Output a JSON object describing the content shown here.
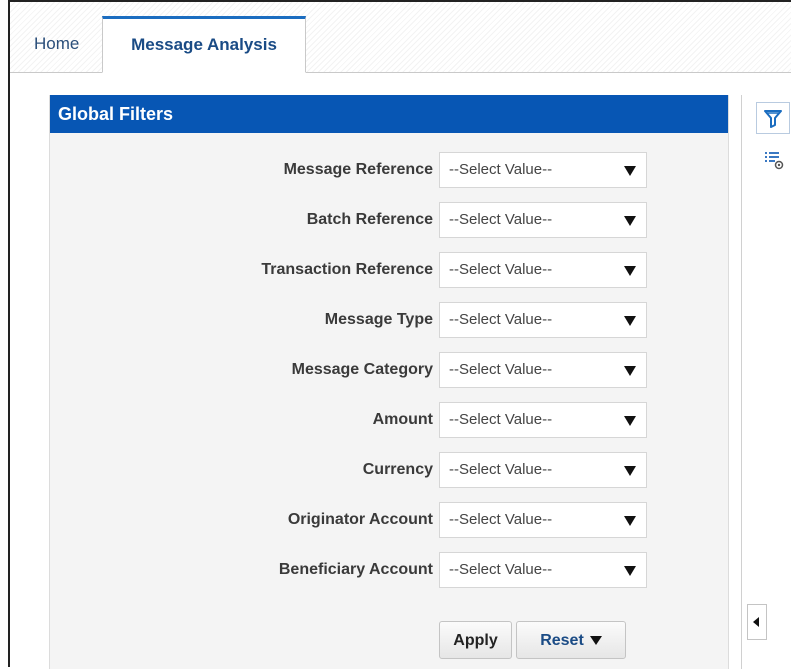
{
  "tabs": [
    {
      "label": "Home",
      "active": false
    },
    {
      "label": "Message Analysis",
      "active": true
    }
  ],
  "panel": {
    "title": "Global Filters",
    "filters": [
      {
        "label": "Message Reference",
        "value": "--Select Value--"
      },
      {
        "label": "Batch Reference",
        "value": "--Select Value--"
      },
      {
        "label": "Transaction Reference",
        "value": "--Select Value--"
      },
      {
        "label": "Message Type",
        "value": "--Select Value--"
      },
      {
        "label": "Message Category",
        "value": "--Select Value--"
      },
      {
        "label": "Amount",
        "value": "--Select Value--"
      },
      {
        "label": "Currency",
        "value": "--Select Value--"
      },
      {
        "label": "Originator Account",
        "value": "--Select Value--"
      },
      {
        "label": "Beneficiary Account",
        "value": "--Select Value--"
      }
    ],
    "apply_label": "Apply",
    "reset_label": "Reset"
  },
  "side_tools": {
    "filter_icon": "filter-icon",
    "list_icon": "list-settings-icon",
    "collapse_icon": "collapse-left-icon"
  },
  "colors": {
    "header_bg": "#0756b4",
    "tab_accent": "#1b6dc0",
    "link_text": "#1a4b85"
  }
}
